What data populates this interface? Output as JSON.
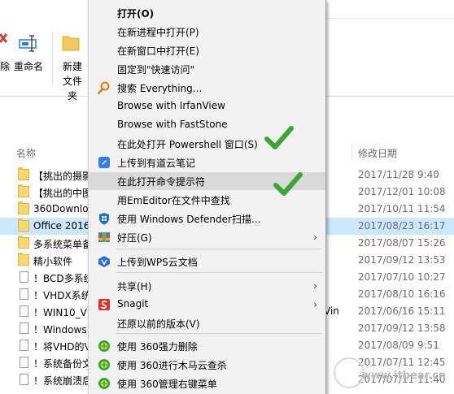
{
  "ribbon": {
    "delete_label": "除",
    "rename_label": "重命名",
    "new_folder_label_1": "新建",
    "new_folder_label_2": "文件夹"
  },
  "file_list": {
    "col_name": "名称",
    "col_date": "修改日期",
    "rows": [
      {
        "icon": "folder",
        "name": "【挑出的摄影",
        "date": "2017/11/28 9:40",
        "extra": ""
      },
      {
        "icon": "folder",
        "name": "【挑出的中图",
        "date": "2017/12/01 10:08",
        "extra": ""
      },
      {
        "icon": "folder",
        "name": "360Downloa",
        "date": "2017/10/11 11:54",
        "extra": ""
      },
      {
        "icon": "folder",
        "name": "Office 2016",
        "date": "2017/08/23 16:17",
        "extra": "",
        "selected": true
      },
      {
        "icon": "folder",
        "name": "多系统菜单备",
        "date": "2017/08/07 15:26",
        "extra": ""
      },
      {
        "icon": "folder",
        "name": "精小软件",
        "date": "2017/09/12 13:53",
        "extra": ""
      },
      {
        "icon": "doc",
        "name": "！BCD多系统",
        "date": "2017/07/10 10:27",
        "extra": ""
      },
      {
        "icon": "doc",
        "name": "！VHDX系统",
        "date": "2017/08/10 16:16",
        "extra": ""
      },
      {
        "icon": "doc",
        "name": "！WIN10_VI",
        "date": "2017/06/16 15:11",
        "extra": "Vin"
      },
      {
        "icon": "doc",
        "name": "！Windows",
        "date": "2017/09/12 13:58",
        "extra": ""
      },
      {
        "icon": "doc",
        "name": "！将VHD的V",
        "date": "2017/08/09 9:51",
        "extra": ""
      },
      {
        "icon": "doc",
        "name": "！系统备份文",
        "date": "2017/07/11 12:45",
        "extra": ""
      },
      {
        "icon": "doc",
        "name": "！系统崩溃后",
        "date": "2017/07/11 11:40",
        "extra": ""
      }
    ]
  },
  "context_menu": {
    "items": [
      {
        "label": "打开(O)",
        "bold": true,
        "icon": "none",
        "arrow": false
      },
      {
        "label": "在新进程中打开(P)",
        "icon": "none",
        "arrow": false
      },
      {
        "label": "在新窗口中打开(E)",
        "icon": "none",
        "arrow": false
      },
      {
        "label": "固定到\"快速访问\"",
        "icon": "none",
        "arrow": false
      },
      {
        "label": "搜索 Everything...",
        "icon": "everything-search-icon",
        "arrow": false
      },
      {
        "label": "Browse with IrfanView",
        "icon": "none",
        "arrow": false
      },
      {
        "label": "Browse with FastStone",
        "icon": "none",
        "arrow": false
      },
      {
        "label": "在此处打开 Powershell 窗口(S)",
        "icon": "none",
        "arrow": false
      },
      {
        "label": "上传到有道云笔记",
        "icon": "youdao-note-icon",
        "arrow": false
      },
      {
        "label": "在此打开命令提示符",
        "icon": "none",
        "arrow": false,
        "highlighted": true
      },
      {
        "label": "用EmEditor在文件中查找",
        "icon": "none",
        "arrow": false
      },
      {
        "label": "使用 Windows Defender扫描...",
        "icon": "windows-defender-icon",
        "arrow": false
      },
      {
        "label": "好压(G)",
        "icon": "haozip-icon",
        "arrow": true
      },
      {
        "label": "上传到WPS云文档",
        "icon": "wps-cloud-icon",
        "arrow": false
      },
      {
        "label": "共享(H)",
        "icon": "none",
        "arrow": true
      },
      {
        "label": "Snagit",
        "icon": "snagit-icon",
        "arrow": true
      },
      {
        "label": "还原以前的版本(V)",
        "icon": "none",
        "arrow": false
      },
      {
        "label": "使用 360强力删除",
        "icon": "360-delete-icon",
        "arrow": false
      },
      {
        "label": "使用 360进行木马云查杀",
        "icon": "360-scan-icon",
        "arrow": false
      },
      {
        "label": "使用 360管理右键菜单",
        "icon": "360-manage-icon",
        "arrow": false
      }
    ]
  },
  "colors": {
    "menu_bg": "#f2f2f2",
    "highlight": "#dadada",
    "selection": "#cce8ff",
    "check": "#3aa636"
  },
  "watermark": "www.itbear.cn"
}
